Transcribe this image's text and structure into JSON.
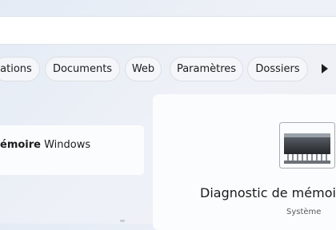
{
  "filters": {
    "chips": [
      {
        "label": "cations"
      },
      {
        "label": "Documents"
      },
      {
        "label": "Web"
      },
      {
        "label": "Paramètres"
      },
      {
        "label": "Dossiers"
      }
    ]
  },
  "results": {
    "best_match": {
      "bold": "émoire",
      "rest": " Windows"
    }
  },
  "detail": {
    "title": "Diagnostic de mémoi",
    "subtitle": "Système",
    "icon": "memory-chip-icon"
  },
  "colors": {
    "accent": "#fbfcfd",
    "chip_bg": "#f5f6f9",
    "chip_border": "#dcdfe5"
  }
}
